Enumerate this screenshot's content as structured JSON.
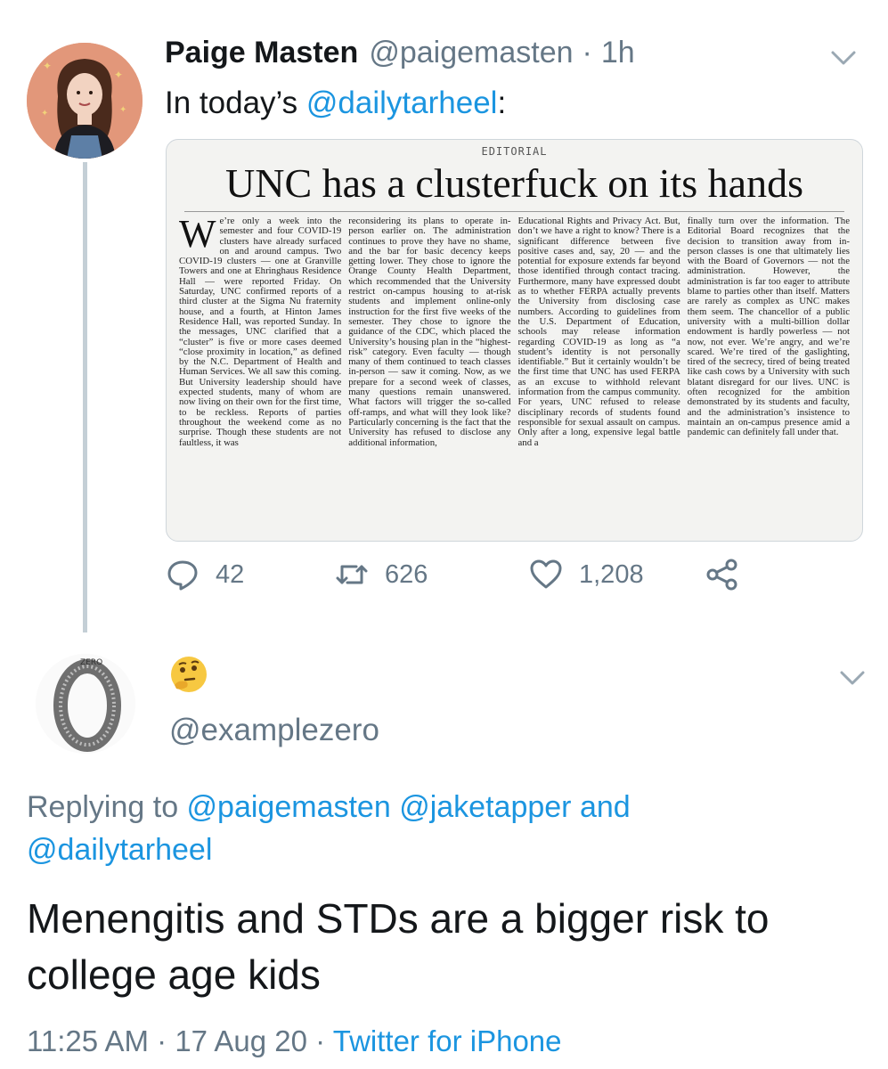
{
  "tweet": {
    "author_name": "Paige Masten",
    "author_handle": "@paigemasten",
    "time_ago": "1h",
    "text_prefix": "In today’s ",
    "text_mention": "@dailytarheel",
    "text_suffix": ":",
    "image": {
      "kicker": "EDITORIAL",
      "headline": "UNC has a clusterfuck on its hands",
      "columns": [
        "e’re only a week into the semester and four COVID-19 clusters have already surfaced on and around campus. Two COVID-19 clusters — one at Granville Towers and one at Ehringhaus Residence Hall — were reported Friday. On Saturday, UNC confirmed reports of a third cluster at the Sigma Nu fraternity house, and a fourth, at Hinton James Residence Hall, was reported Sunday. In the messages, UNC clarified that a “cluster” is five or more cases deemed “close proximity in location,” as defined by the N.C. Department of Health and Human Services. We all saw this coming. But University leadership should have expected students, many of whom are now living on their own for the first time, to be reckless. Reports of parties throughout the weekend come as no surprise. Though these students are not faultless, it was",
        "reconsidering its plans to operate in-person earlier on. The administration continues to prove they have no shame, and the bar for basic decency keeps getting lower. They chose to ignore the Orange County Health Department, which recommended that the University restrict on-campus housing to at-risk students and implement online-only instruction for the first five weeks of the semester. They chose to ignore the guidance of the CDC, which placed the University’s housing plan in the “highest-risk” category. Even faculty — though many of them continued to teach classes in-person — saw it coming. Now, as we prepare for a second week of classes, many questions remain unanswered. What factors will trigger the so-called off-ramps, and what will they look like? Particularly concerning is the fact that the University has refused to disclose any additional information,",
        "Educational Rights and Privacy Act. But, don’t we have a right to know? There is a significant difference between five positive cases and, say, 20 — and the potential for exposure extends far beyond those identified through contact tracing. Furthermore, many have expressed doubt as to whether FERPA actually prevents the University from disclosing case numbers. According to guidelines from the U.S. Department of Education, schools may release information regarding COVID-19 as long as “a student’s identity is not personally identifiable.” But it certainly wouldn’t be the first time that UNC has used FERPA as an excuse to withhold relevant information from the campus community. For years, UNC refused to release disciplinary records of students found responsible for sexual assault on campus. Only after a long, expensive legal battle and a",
        "finally turn over the information. The Editorial Board recognizes that the decision to transition away from in-person classes is one that ultimately lies with the Board of Governors — not the administration. However, the administration is far too eager to attribute blame to parties other than itself. Matters are rarely as complex as UNC makes them seem. The chancellor of a public university with a multi-billion dollar endowment is hardly powerless — not now, not ever. We’re angry, and we’re scared. We’re tired of the gaslighting, tired of the secrecy, tired of being treated like cash cows by a University with such blatant disregard for our lives. UNC is often recognized for the ambition demonstrated by its students and faculty, and the administration’s insistence to maintain an on-campus presence amid a pandemic can definitely fall under that."
      ]
    },
    "counts": {
      "replies": "42",
      "retweets": "626",
      "likes": "1,208"
    }
  },
  "reply": {
    "display_name": "🤔",
    "handle": "@examplezero",
    "avatar_text": "ZERO",
    "replying_label": "Replying to ",
    "replying_to_1": "@paigemasten",
    "replying_to_2": "@jaketapper",
    "replying_and": " and",
    "replying_to_3": "@dailytarheel",
    "text": "Menengitis and STDs are a bigger risk to college age kids",
    "time": "11:25 AM",
    "date": "17 Aug 20",
    "source": "Twitter for iPhone",
    "separator": "·"
  },
  "colors": {
    "accent": "#1b95e0",
    "muted": "#657786",
    "text": "#14171a"
  },
  "icons": [
    "avatar-illustration",
    "chevron-down-icon",
    "reply-icon",
    "retweet-icon",
    "like-icon",
    "share-icon",
    "thinking-face-emoji"
  ]
}
